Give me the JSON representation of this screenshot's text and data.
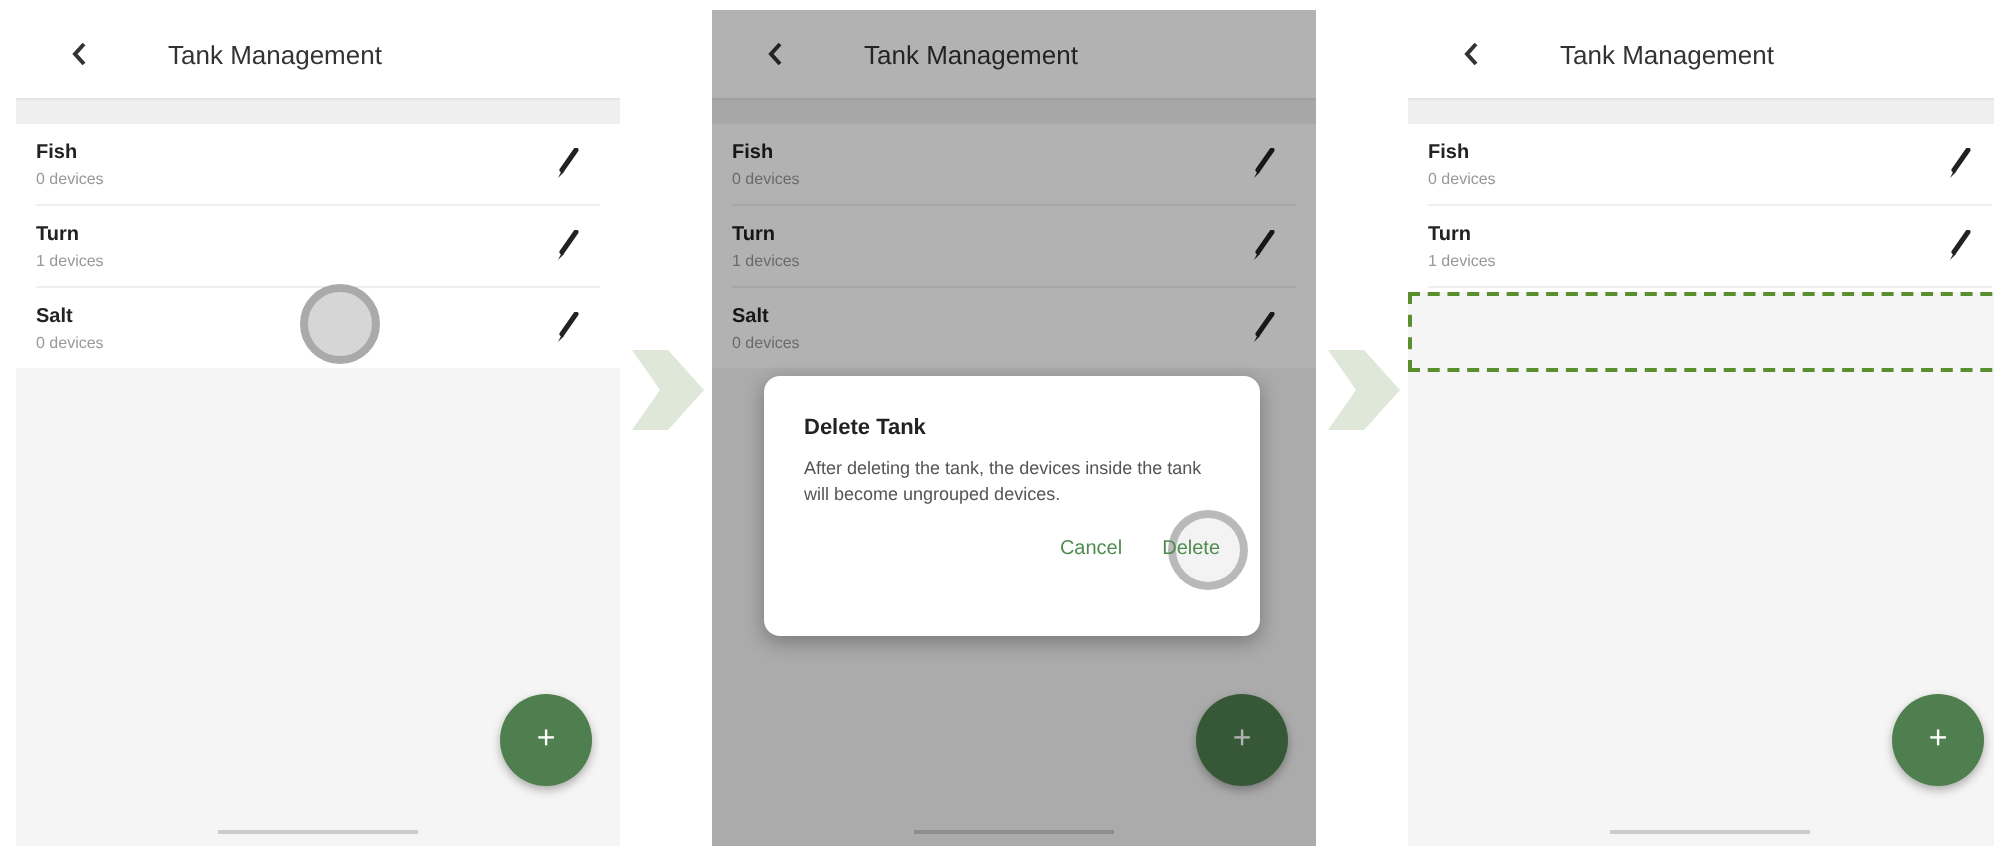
{
  "screens": [
    {
      "title": "Tank Management",
      "dimmed": false,
      "tanks": [
        {
          "name": "Fish",
          "devices": "0 devices",
          "touched": false,
          "removed": false
        },
        {
          "name": "Turn",
          "devices": "1 devices",
          "touched": false,
          "removed": false
        },
        {
          "name": "Salt",
          "devices": "0 devices",
          "touched": true,
          "removed": false
        }
      ],
      "fab": "+"
    },
    {
      "title": "Tank Management",
      "dimmed": true,
      "tanks": [
        {
          "name": "Fish",
          "devices": "0 devices",
          "touched": false,
          "removed": false
        },
        {
          "name": "Turn",
          "devices": "1 devices",
          "touched": false,
          "removed": false
        },
        {
          "name": "Salt",
          "devices": "0 devices",
          "touched": false,
          "removed": false
        }
      ],
      "dialog": {
        "title": "Delete Tank",
        "message": "After deleting the tank, the devices inside the tank will become ungrouped devices.",
        "buttons": [
          {
            "label": "Cancel",
            "touched": false
          },
          {
            "label": "Delete",
            "touched": true
          }
        ]
      },
      "fab": "+"
    },
    {
      "title": "Tank Management",
      "dimmed": false,
      "tanks": [
        {
          "name": "Fish",
          "devices": "0 devices",
          "touched": false,
          "removed": false
        },
        {
          "name": "Turn",
          "devices": "1 devices",
          "touched": false,
          "removed": false
        },
        {
          "touched": false,
          "removed": true
        }
      ],
      "fab": "+"
    }
  ]
}
